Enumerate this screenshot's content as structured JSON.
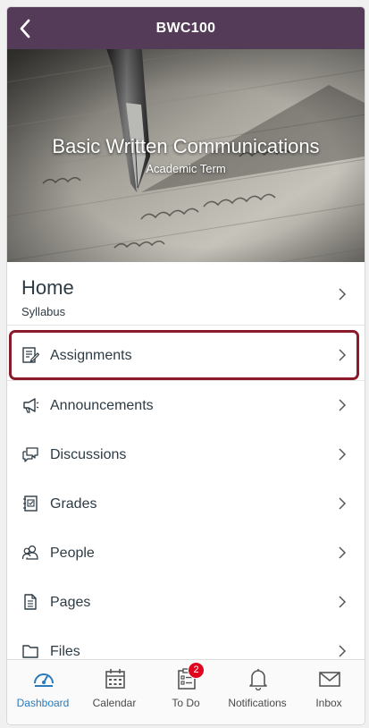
{
  "header": {
    "course_code": "BWC100",
    "back_icon": "chevron-left-icon"
  },
  "hero": {
    "course_name": "Basic Written Communications",
    "term": "Academic Term"
  },
  "home": {
    "title": "Home",
    "subtitle": "Syllabus"
  },
  "menu": [
    {
      "label": "Assignments",
      "icon": "assignment-icon",
      "highlighted": true
    },
    {
      "label": "Announcements",
      "icon": "megaphone-icon"
    },
    {
      "label": "Discussions",
      "icon": "discussion-icon"
    },
    {
      "label": "Grades",
      "icon": "gradebook-icon"
    },
    {
      "label": "People",
      "icon": "people-icon"
    },
    {
      "label": "Pages",
      "icon": "page-icon"
    },
    {
      "label": "Files",
      "icon": "folder-icon"
    }
  ],
  "tabs": [
    {
      "label": "Dashboard",
      "icon": "dashboard-icon",
      "active": true
    },
    {
      "label": "Calendar",
      "icon": "calendar-icon"
    },
    {
      "label": "To Do",
      "icon": "todo-icon",
      "badge": "2"
    },
    {
      "label": "Notifications",
      "icon": "bell-icon"
    },
    {
      "label": "Inbox",
      "icon": "envelope-icon"
    }
  ],
  "colors": {
    "header": "#543b58",
    "accent": "#2b7abc",
    "highlight": "#8b1a2a",
    "badge": "#e0061f",
    "text": "#2d3b45"
  }
}
